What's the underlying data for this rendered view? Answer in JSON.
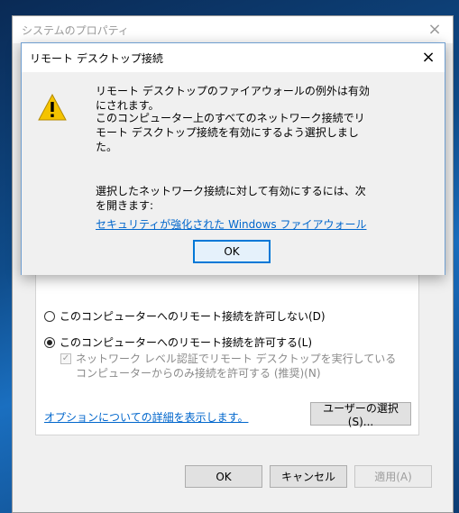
{
  "background_window": {
    "title": "システムのプロパティ",
    "close": "×",
    "radio_disallow": "このコンピューターへのリモート接続を許可しない(D)",
    "radio_allow": "このコンピューターへのリモート接続を許可する(L)",
    "nla_checkbox": "ネットワーク レベル認証でリモート デスクトップを実行しているコンピューターからのみ接続を許可する (推奨)(N)",
    "options_link": "オプションについての詳細を表示します。",
    "select_users_button": "ユーザーの選択(S)...",
    "ok_button": "OK",
    "cancel_button": "キャンセル",
    "apply_button": "適用(A)"
  },
  "dialog": {
    "title": "リモート デスクトップ接続",
    "close": "×",
    "message1": "リモート デスクトップのファイアウォールの例外は有効にされます。",
    "message2": "このコンピューター上のすべてのネットワーク接続でリモート デスクトップ接続を有効にするよう選択しました。",
    "message3": "選択したネットワーク接続に対して有効にするには、次を開きます:",
    "link": "セキュリティが強化された Windows ファイアウォール",
    "ok_button": "OK"
  },
  "colors": {
    "link": "#0066cc",
    "default_button_border": "#0078d7",
    "warning_icon": "#f4c300"
  },
  "icons": {
    "dialog_icon": "warning-icon",
    "nla_check_mark": "✓"
  }
}
